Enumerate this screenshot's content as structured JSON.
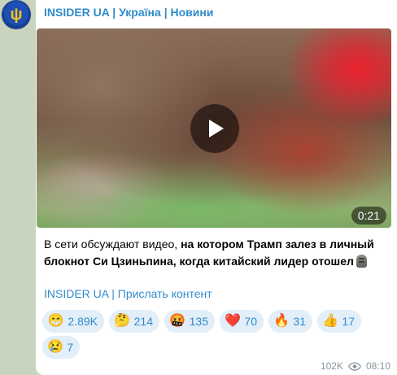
{
  "channel": {
    "name_parts": [
      "INSIDER UA",
      "Україна",
      "Новини"
    ],
    "separator": "|"
  },
  "video": {
    "duration": "0:21",
    "play_icon": "play-icon"
  },
  "message": {
    "text_plain": "В сети обсуждают видео, ",
    "text_bold": "на котором Трамп залез в личный блокнот Си Цзиньпина, когда китайский лидер отошел",
    "trailing_emoji": "moai-stone-icon"
  },
  "links": {
    "channel_link": "INSIDER UA",
    "divider": "|",
    "submit_link": "Прислать контент"
  },
  "reactions": [
    {
      "emoji": "😁",
      "count": "2.89K"
    },
    {
      "emoji": "🤔",
      "count": "214"
    },
    {
      "emoji": "🤬",
      "count": "135"
    },
    {
      "emoji": "❤️",
      "count": "70"
    },
    {
      "emoji": "🔥",
      "count": "31"
    },
    {
      "emoji": "👍",
      "count": "17"
    },
    {
      "emoji": "😢",
      "count": "7"
    }
  ],
  "meta": {
    "views": "102K",
    "time": "08:10"
  },
  "colors": {
    "accent": "#2f8bcb",
    "reaction_bg": "#e2eef8",
    "background": "#c8d3c0"
  }
}
